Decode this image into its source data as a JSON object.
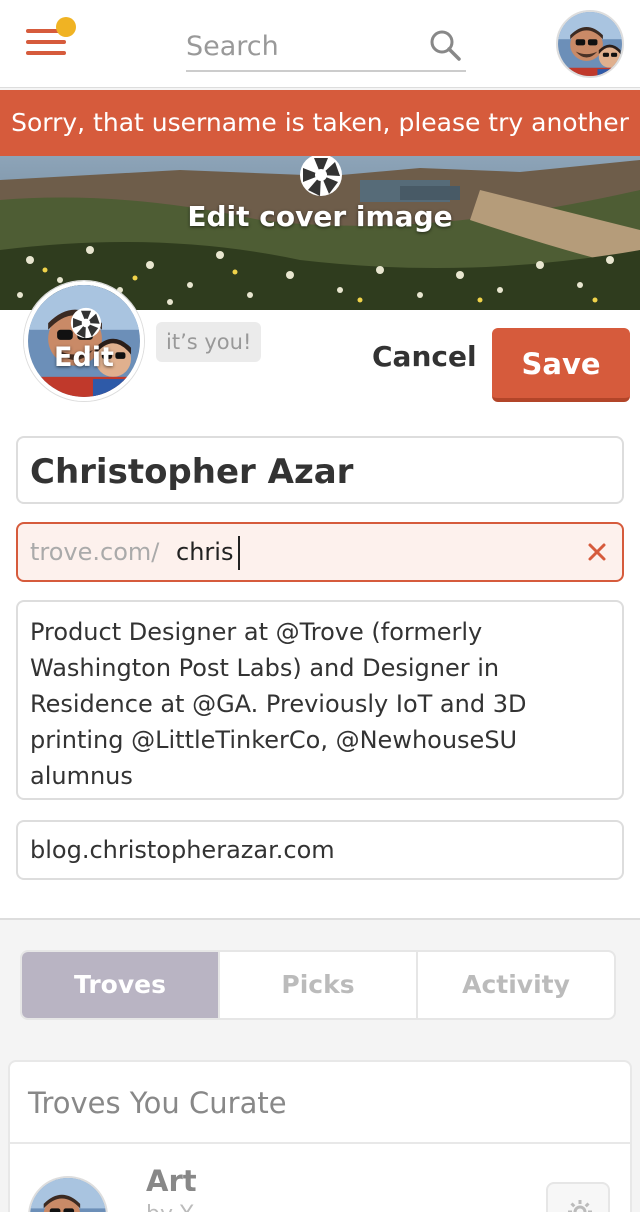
{
  "header": {
    "search_placeholder": "Search",
    "notification_color": "#f0b323",
    "menu_icon": "hamburger-icon",
    "search_icon": "search-icon"
  },
  "error_banner": {
    "message": "Sorry, that username is taken, please try another",
    "color": "#d65b3c"
  },
  "cover": {
    "edit_label": "Edit cover image",
    "icon": "camera-icon"
  },
  "profile": {
    "avatar_edit_label": "Edit",
    "its_you_label": "it’s you!",
    "cancel_label": "Cancel",
    "save_label": "Save",
    "accent_color": "#d65b3c"
  },
  "form": {
    "name_value": "Christopher Azar",
    "url_prefix": "trove.com/",
    "url_value": "chris",
    "url_error": true,
    "bio_value": "Product Designer at @Trove (formerly Washington Post Labs) and Designer in Residence at @GA. Previously IoT and 3D printing @LittleTinkerCo, @NewhouseSU alumnus",
    "website_value": "blog.christopherazar.com"
  },
  "tabs": [
    {
      "label": "Troves",
      "active": true
    },
    {
      "label": "Picks",
      "active": false
    },
    {
      "label": "Activity",
      "active": false
    }
  ],
  "troves_card": {
    "title": "Troves You Curate",
    "items": [
      {
        "name": "Art",
        "subtitle": "by Y",
        "icon": "gear-icon"
      }
    ]
  }
}
